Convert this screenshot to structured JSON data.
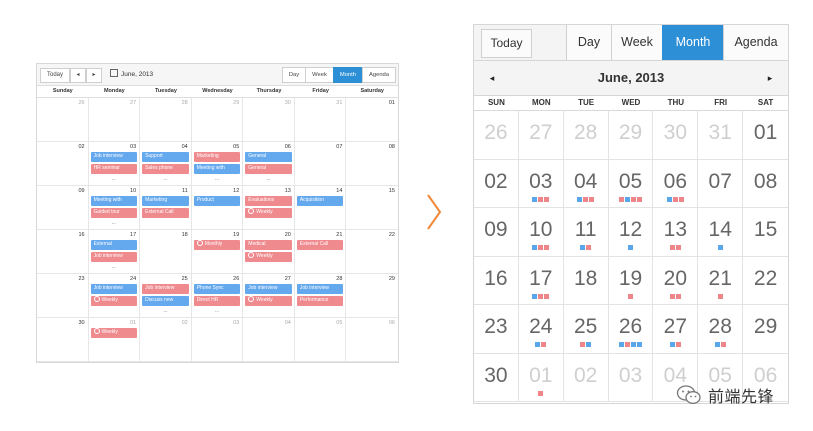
{
  "desktop": {
    "toolbar": {
      "today": "Today",
      "prev": "◂",
      "next": "▸",
      "date": "June, 2013"
    },
    "views": [
      "Day",
      "Week",
      "Month",
      "Agenda"
    ],
    "active_view": "Month",
    "weekdays": [
      "Sunday",
      "Monday",
      "Tuesday",
      "Wednesday",
      "Thursday",
      "Friday",
      "Saturday"
    ],
    "weeks": [
      [
        {
          "d": "26",
          "dim": true
        },
        {
          "d": "27",
          "dim": true
        },
        {
          "d": "28",
          "dim": true
        },
        {
          "d": "29",
          "dim": true
        },
        {
          "d": "30",
          "dim": true
        },
        {
          "d": "31",
          "dim": true
        },
        {
          "d": "01"
        }
      ],
      [
        {
          "d": "02"
        },
        {
          "d": "03",
          "ev": [
            {
              "t": "Job interview",
              "c": "blue"
            },
            {
              "t": "HR seminar",
              "c": "red"
            }
          ],
          "more": "..."
        },
        {
          "d": "04",
          "ev": [
            {
              "t": "Support",
              "c": "blue"
            },
            {
              "t": "Sales phone",
              "c": "red"
            }
          ],
          "more": "..."
        },
        {
          "d": "05",
          "ev": [
            {
              "t": "Marketing",
              "c": "red"
            },
            {
              "t": "Meeting with",
              "c": "blue"
            }
          ],
          "more": "..."
        },
        {
          "d": "06",
          "ev": [
            {
              "t": "General",
              "c": "blue"
            },
            {
              "t": "General",
              "c": "red"
            }
          ],
          "more": "..."
        },
        {
          "d": "07"
        },
        {
          "d": "08"
        }
      ],
      [
        {
          "d": "09"
        },
        {
          "d": "10",
          "ev": [
            {
              "t": "Meeting with",
              "c": "blue"
            },
            {
              "t": "Guided tour",
              "c": "red"
            }
          ],
          "more": "..."
        },
        {
          "d": "11",
          "ev": [
            {
              "t": "Marketing",
              "c": "blue"
            },
            {
              "t": "External Call",
              "c": "red"
            }
          ]
        },
        {
          "d": "12",
          "ev": [
            {
              "t": "Product",
              "c": "blue"
            }
          ]
        },
        {
          "d": "13",
          "ev": [
            {
              "t": "Evaluations",
              "c": "red"
            },
            {
              "t": "Weekly",
              "c": "red",
              "check": true
            }
          ]
        },
        {
          "d": "14",
          "ev": [
            {
              "t": "Acquisition",
              "c": "blue"
            }
          ]
        },
        {
          "d": "15"
        }
      ],
      [
        {
          "d": "16"
        },
        {
          "d": "17",
          "ev": [
            {
              "t": "External",
              "c": "blue"
            },
            {
              "t": "Job interview",
              "c": "red"
            }
          ],
          "more": "..."
        },
        {
          "d": "18"
        },
        {
          "d": "19",
          "ev": [
            {
              "t": "Monthly",
              "c": "red",
              "check": true
            }
          ]
        },
        {
          "d": "20",
          "ev": [
            {
              "t": "Medical",
              "c": "red"
            },
            {
              "t": "Weekly",
              "c": "red",
              "check": true
            }
          ]
        },
        {
          "d": "21",
          "ev": [
            {
              "t": "External Call",
              "c": "red"
            }
          ]
        },
        {
          "d": "22"
        }
      ],
      [
        {
          "d": "23"
        },
        {
          "d": "24",
          "ev": [
            {
              "t": "Job interview",
              "c": "blue"
            },
            {
              "t": "Weekly",
              "c": "red",
              "check": true
            }
          ]
        },
        {
          "d": "25",
          "ev": [
            {
              "t": "Job interview",
              "c": "red"
            },
            {
              "t": "Discuss new",
              "c": "blue"
            }
          ],
          "more": "..."
        },
        {
          "d": "26",
          "ev": [
            {
              "t": "Phone Sync",
              "c": "blue"
            },
            {
              "t": "Direct HR",
              "c": "red"
            }
          ],
          "more": "..."
        },
        {
          "d": "27",
          "ev": [
            {
              "t": "Job interview",
              "c": "blue"
            },
            {
              "t": "Weekly",
              "c": "red",
              "check": true
            }
          ]
        },
        {
          "d": "28",
          "ev": [
            {
              "t": "Job interview",
              "c": "blue"
            },
            {
              "t": "Performance",
              "c": "red"
            }
          ]
        },
        {
          "d": "29"
        }
      ],
      [
        {
          "d": "30"
        },
        {
          "d": "01",
          "dim": true,
          "ev": [
            {
              "t": "Weekly",
              "c": "red",
              "check": true
            }
          ]
        },
        {
          "d": "02",
          "dim": true
        },
        {
          "d": "03",
          "dim": true
        },
        {
          "d": "04",
          "dim": true
        },
        {
          "d": "05",
          "dim": true
        },
        {
          "d": "06",
          "dim": true
        }
      ]
    ]
  },
  "mobile": {
    "today": "Today",
    "views": [
      "Day",
      "Week",
      "Month",
      "Agenda"
    ],
    "active_view": "Month",
    "prev": "◂",
    "next": "▸",
    "title": "June, 2013",
    "weekdays": [
      "SUN",
      "MON",
      "TUE",
      "WED",
      "THU",
      "FRI",
      "SAT"
    ],
    "weeks": [
      [
        {
          "d": "26",
          "dim": true
        },
        {
          "d": "27",
          "dim": true
        },
        {
          "d": "28",
          "dim": true
        },
        {
          "d": "29",
          "dim": true
        },
        {
          "d": "30",
          "dim": true
        },
        {
          "d": "31",
          "dim": true
        },
        {
          "d": "01"
        }
      ],
      [
        {
          "d": "02"
        },
        {
          "d": "03",
          "dots": "brr"
        },
        {
          "d": "04",
          "dots": "brr"
        },
        {
          "d": "05",
          "dots": "rbrr"
        },
        {
          "d": "06",
          "dots": "brr"
        },
        {
          "d": "07"
        },
        {
          "d": "08"
        }
      ],
      [
        {
          "d": "09"
        },
        {
          "d": "10",
          "dots": "brr"
        },
        {
          "d": "11",
          "dots": "br"
        },
        {
          "d": "12",
          "dots": "b"
        },
        {
          "d": "13",
          "dots": "rr"
        },
        {
          "d": "14",
          "dots": "b"
        },
        {
          "d": "15"
        }
      ],
      [
        {
          "d": "16"
        },
        {
          "d": "17",
          "dots": "brr"
        },
        {
          "d": "18"
        },
        {
          "d": "19",
          "dots": "r"
        },
        {
          "d": "20",
          "dots": "rr"
        },
        {
          "d": "21",
          "dots": "r"
        },
        {
          "d": "22"
        }
      ],
      [
        {
          "d": "23"
        },
        {
          "d": "24",
          "dots": "br"
        },
        {
          "d": "25",
          "dots": "rb"
        },
        {
          "d": "26",
          "dots": "brbb"
        },
        {
          "d": "27",
          "dots": "br"
        },
        {
          "d": "28",
          "dots": "br"
        },
        {
          "d": "29"
        }
      ],
      [
        {
          "d": "30"
        },
        {
          "d": "01",
          "dim": true,
          "dots": "r"
        },
        {
          "d": "02",
          "dim": true
        },
        {
          "d": "03",
          "dim": true
        },
        {
          "d": "04",
          "dim": true
        },
        {
          "d": "05",
          "dim": true
        },
        {
          "d": "06",
          "dim": true
        }
      ]
    ]
  },
  "watermark": {
    "text": "前端先锋"
  },
  "colors": {
    "accent": "#2d8fd6",
    "event_blue": "#64a8ee",
    "event_red": "#ef8a8e",
    "arrow": "#f0883a"
  }
}
